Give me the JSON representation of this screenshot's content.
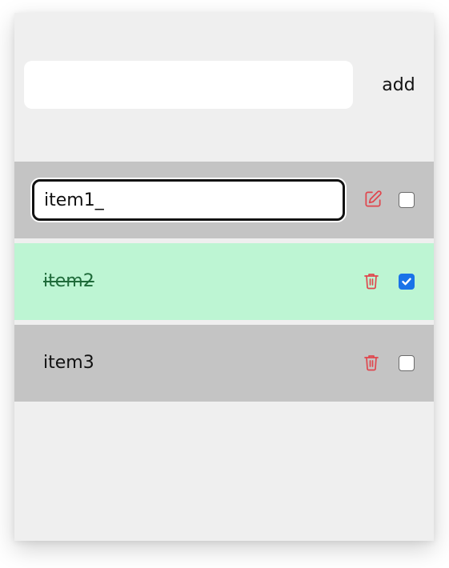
{
  "add_bar": {
    "input_value": "",
    "add_label": "add"
  },
  "items": [
    {
      "text": "item1_",
      "editing": true,
      "done": false,
      "action_icon": "edit-icon"
    },
    {
      "text": "item2",
      "editing": false,
      "done": true,
      "action_icon": "trash-icon"
    },
    {
      "text": "item3",
      "editing": false,
      "done": false,
      "action_icon": "trash-icon"
    }
  ],
  "colors": {
    "card_bg": "#efefef",
    "item_bg": "#c4c4c4",
    "item_done_bg": "#bdf5d3",
    "done_text": "#1f6b3a",
    "icon_red": "#e0464d",
    "checkbox_blue": "#1a73e8"
  }
}
